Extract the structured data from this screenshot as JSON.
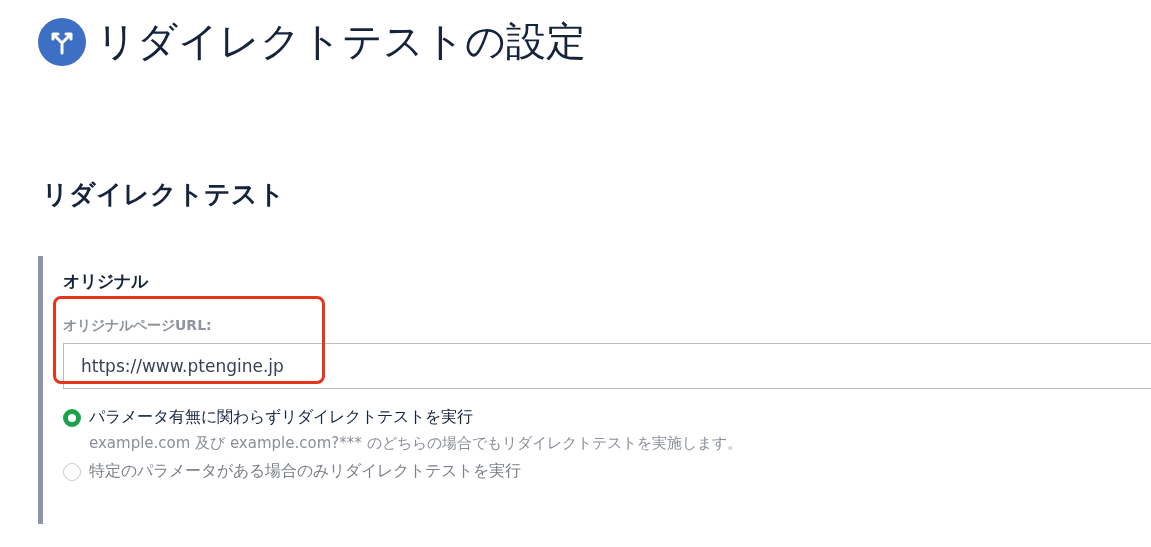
{
  "page": {
    "title": "リダイレクトテストの設定"
  },
  "section": {
    "heading": "リダイレクトテスト"
  },
  "card": {
    "title": "オリジナル",
    "url_field": {
      "label": "オリジナルページURL:",
      "value": "https://www.ptengine.jp",
      "highlighted": true
    },
    "options": [
      {
        "label": "パラメータ有無に関わらずリダイレクトテストを実行",
        "description": "example.com 及び example.com?*** のどちらの場合でもリダイレクトテストを実施します。",
        "selected": true
      },
      {
        "label": "特定のパラメータがある場合のみリダイレクトテストを実行",
        "selected": false
      }
    ]
  }
}
